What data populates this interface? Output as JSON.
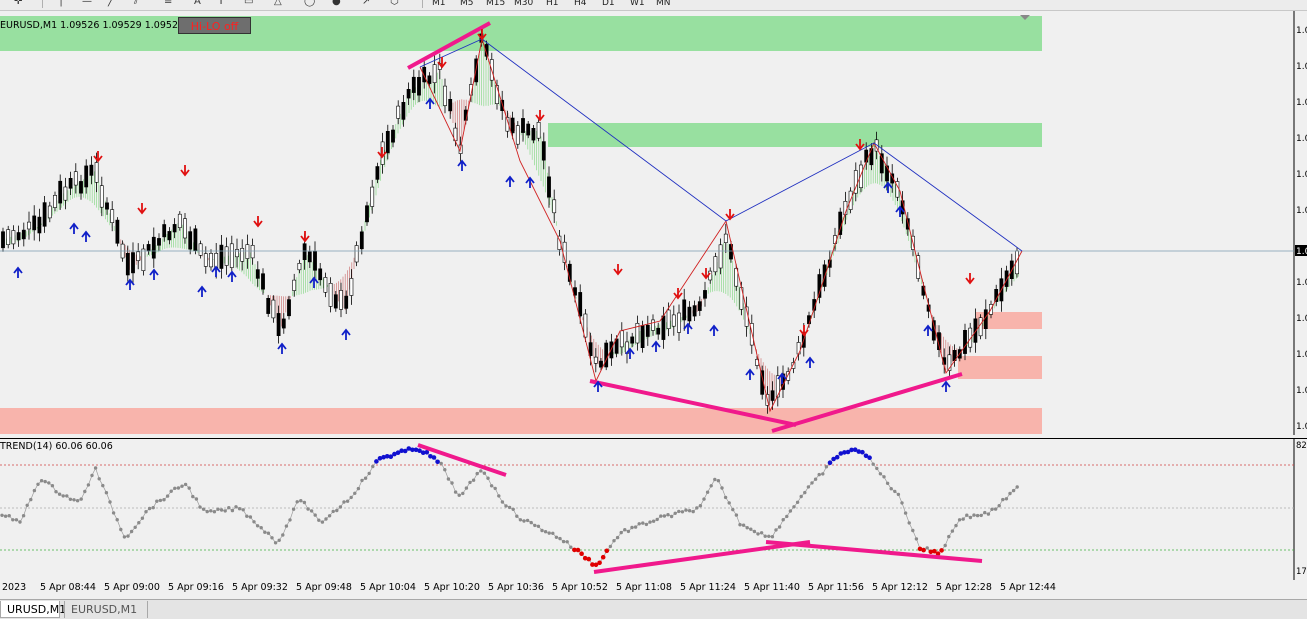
{
  "toolbar": {
    "timeframes": [
      "M1",
      "M5",
      "M15",
      "M30",
      "H1",
      "H4",
      "D1",
      "W1",
      "MN"
    ]
  },
  "main_chart": {
    "symbol_info": "EURUSD,M1  1.09526 1.09529 1.09523 1.09",
    "hilo_button": "Hi-LO off",
    "price_tick_prefix": "1.0",
    "current_price_tag": "1.0"
  },
  "indicator": {
    "info": "TREND(14) 60.06 60.06",
    "scale_max": "82.",
    "scale_min": "17."
  },
  "time_axis": {
    "labels": [
      "2023",
      "5 Apr 08:44",
      "5 Apr 09:00",
      "5 Apr 09:16",
      "5 Apr 09:32",
      "5 Apr 09:48",
      "5 Apr 10:04",
      "5 Apr 10:20",
      "5 Apr 10:36",
      "5 Apr 10:52",
      "5 Apr 11:08",
      "5 Apr 11:24",
      "5 Apr 11:40",
      "5 Apr 11:56",
      "5 Apr 12:12",
      "5 Apr 12:28",
      "5 Apr 12:44"
    ]
  },
  "tabs": [
    {
      "label": "URUSD,M1",
      "active": true
    },
    {
      "label": "EURUSD,M1",
      "active": false
    }
  ],
  "colors": {
    "bull_zone": "#98e0a0",
    "bear_zone": "#f8b4ac",
    "bull_hist": "#7cd67c",
    "bear_hist": "#c86464",
    "down_arrow": "#e01010",
    "up_arrow": "#1020c8",
    "divergence": "#f0198c",
    "zigzag": "#d02020",
    "trendline": "#2030c0",
    "dot_normal": "#8a8a8a",
    "dot_overbought": "#1010d0",
    "dot_oversold": "#e00000"
  }
}
